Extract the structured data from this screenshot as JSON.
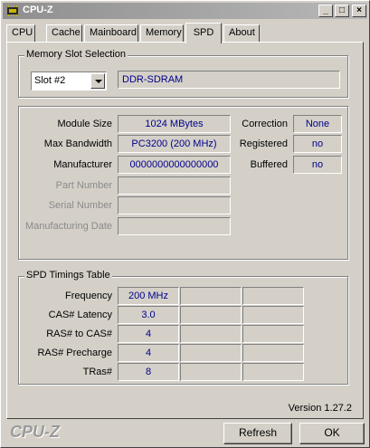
{
  "window": {
    "title": "CPU-Z",
    "minimize_icon": "minimize-icon",
    "maximize_icon": "maximize-icon",
    "close_icon": "close-icon"
  },
  "tabs": [
    {
      "label": "CPU"
    },
    {
      "label": "Cache"
    },
    {
      "label": "Mainboard"
    },
    {
      "label": "Memory"
    },
    {
      "label": "SPD",
      "active": true
    },
    {
      "label": "About"
    }
  ],
  "slot_section": {
    "title": "Memory Slot Selection",
    "selected_slot": "Slot #2",
    "memory_type": "DDR-SDRAM"
  },
  "module_info": {
    "module_size_label": "Module Size",
    "module_size": "1024 MBytes",
    "max_bandwidth_label": "Max Bandwidth",
    "max_bandwidth": "PC3200 (200 MHz)",
    "manufacturer_label": "Manufacturer",
    "manufacturer": "0000000000000000",
    "part_number_label": "Part Number",
    "part_number": "",
    "serial_number_label": "Serial Number",
    "serial_number": "",
    "manufacturing_date_label": "Manufacturing Date",
    "manufacturing_date": "",
    "correction_label": "Correction",
    "correction": "None",
    "registered_label": "Registered",
    "registered": "no",
    "buffered_label": "Buffered",
    "buffered": "no"
  },
  "timings": {
    "title": "SPD Timings Table",
    "rows": [
      {
        "label": "Frequency",
        "value": "200 MHz"
      },
      {
        "label": "CAS# Latency",
        "value": "3.0"
      },
      {
        "label": "RAS# to CAS#",
        "value": "4"
      },
      {
        "label": "RAS# Precharge",
        "value": "4"
      },
      {
        "label": "TRas#",
        "value": "8"
      }
    ]
  },
  "footer": {
    "version": "Version 1.27.2",
    "brand": "CPU-Z",
    "refresh_label": "Refresh",
    "ok_label": "OK"
  }
}
